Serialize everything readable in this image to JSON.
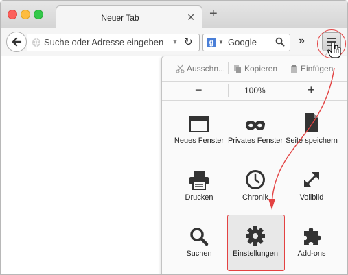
{
  "window": {
    "tab": {
      "title": "Neuer Tab",
      "close_glyph": "✕"
    },
    "new_tab_glyph": "+"
  },
  "toolbar": {
    "url_placeholder": "Suche oder Adresse eingeben",
    "search_engine_letter": "g",
    "search_placeholder": "Google",
    "overflow_glyph": "»",
    "reload_glyph": "↻",
    "dropdown_glyph": "▼"
  },
  "menu": {
    "edit": {
      "cut": "Ausschn...",
      "copy": "Kopieren",
      "paste": "Einfügen"
    },
    "zoom": {
      "minus": "−",
      "value": "100%",
      "plus": "+"
    },
    "items": [
      {
        "label": "Neues Fenster",
        "icon": "new-window-icon"
      },
      {
        "label": "Privates Fenster",
        "icon": "private-mask-icon"
      },
      {
        "label": "Seite speichern",
        "icon": "save-page-icon"
      },
      {
        "label": "Drucken",
        "icon": "printer-icon"
      },
      {
        "label": "Chronik",
        "icon": "clock-icon"
      },
      {
        "label": "Vollbild",
        "icon": "fullscreen-icon"
      },
      {
        "label": "Suchen",
        "icon": "search-icon"
      },
      {
        "label": "Einstellungen",
        "icon": "gear-icon"
      },
      {
        "label": "Add-ons",
        "icon": "puzzle-icon"
      }
    ]
  },
  "colors": {
    "annotation_red": "#e34242",
    "icon_dark": "#333333"
  }
}
